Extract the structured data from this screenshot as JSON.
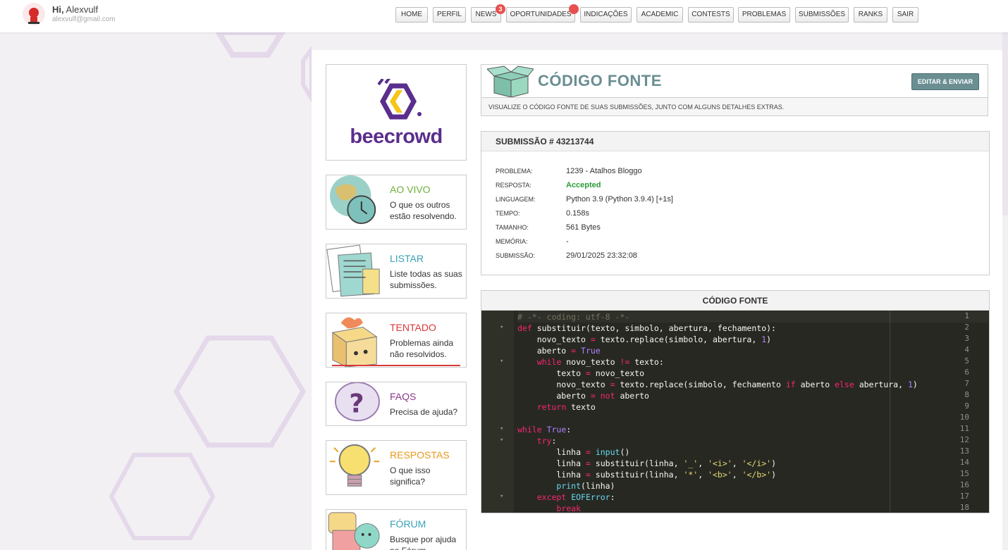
{
  "user": {
    "greeting": "Hi,",
    "name": "Alexvulf",
    "email": "alexvulf@gmail.com"
  },
  "nav": [
    {
      "label": "HOME"
    },
    {
      "label": "PERFIL"
    },
    {
      "label": "NEWS",
      "badge": "3"
    },
    {
      "label": "OPORTUNIDADES",
      "dot": true
    },
    {
      "label": "INDICAÇÕES"
    },
    {
      "label": "ACADEMIC"
    },
    {
      "label": "CONTESTS"
    },
    {
      "label": "PROBLEMAS"
    },
    {
      "label": "SUBMISSÕES"
    },
    {
      "label": "RANKS"
    },
    {
      "label": "SAIR"
    }
  ],
  "logo": {
    "text": "beecrowd",
    "color": "#5a2e8c"
  },
  "cards": [
    {
      "title": "AO VIVO",
      "desc": "O que os outros estão resolvendo.",
      "color": "#6cb03a",
      "icon": "globe-clock-icon"
    },
    {
      "title": "LISTAR",
      "desc": "Liste todas as suas submissões.",
      "color": "#3aa0b8",
      "icon": "notes-icon"
    },
    {
      "title": "TENTADO",
      "desc": "Problemas ainda não resolvidos.",
      "color": "#d83a3a",
      "icon": "burning-box-icon"
    },
    {
      "title": "FAQS",
      "desc": "Precisa de ajuda?",
      "color": "#8a3a8a",
      "icon": "question-bubble-icon"
    },
    {
      "title": "RESPOSTAS",
      "desc": "O que isso significa?",
      "color": "#e89a1a",
      "icon": "lightbulb-icon"
    },
    {
      "title": "FÓRUM",
      "desc": "Busque por ajuda no Fórum.",
      "color": "#3aa0b8",
      "icon": "forum-icon"
    }
  ],
  "header": {
    "title": "CÓDIGO FONTE",
    "button": "EDITAR & ENVIAR",
    "subtitle": "VISUALIZE O CÓDIGO FONTE DE SUAS SUBMISSÕES, JUNTO COM ALGUNS DETALHES EXTRAS."
  },
  "submission": {
    "title": "SUBMISSÃO # 43213744",
    "rows": [
      {
        "key": "PROBLEMA:",
        "value": "1239 - Atalhos Bloggo"
      },
      {
        "key": "RESPOSTA:",
        "value": "Accepted"
      },
      {
        "key": "LINGUAGEM:",
        "value": "Python 3.9 (Python 3.9.4) [+1s]"
      },
      {
        "key": "TEMPO:",
        "value": "0.158s"
      },
      {
        "key": "TAMANHO:",
        "value": "561 Bytes"
      },
      {
        "key": "MEMÓRIA:",
        "value": "-"
      },
      {
        "key": "SUBMISSÃO:",
        "value": "29/01/2025 23:32:08"
      }
    ],
    "accepted_color": "#2a9d3a"
  },
  "code": {
    "title": "CÓDIGO FONTE",
    "lines": [
      "# -*- coding: utf-8 -*-",
      "def substituir(texto, simbolo, abertura, fechamento):",
      "    novo_texto = texto.replace(simbolo, abertura, 1)",
      "    aberto = True",
      "    while novo_texto != texto:",
      "        texto = novo_texto",
      "        novo_texto = texto.replace(simbolo, fechamento if aberto else abertura, 1)",
      "        aberto = not aberto",
      "    return texto",
      "",
      "while True:",
      "    try:",
      "        linha = input()",
      "        linha = substituir(linha, '_', '<i>', '</i>')",
      "        linha = substituir(linha, '*', '<b>', '</b>')",
      "        print(linha)",
      "    except EOFError:",
      "        break"
    ],
    "foldable": [
      2,
      5,
      11,
      12,
      17
    ]
  }
}
